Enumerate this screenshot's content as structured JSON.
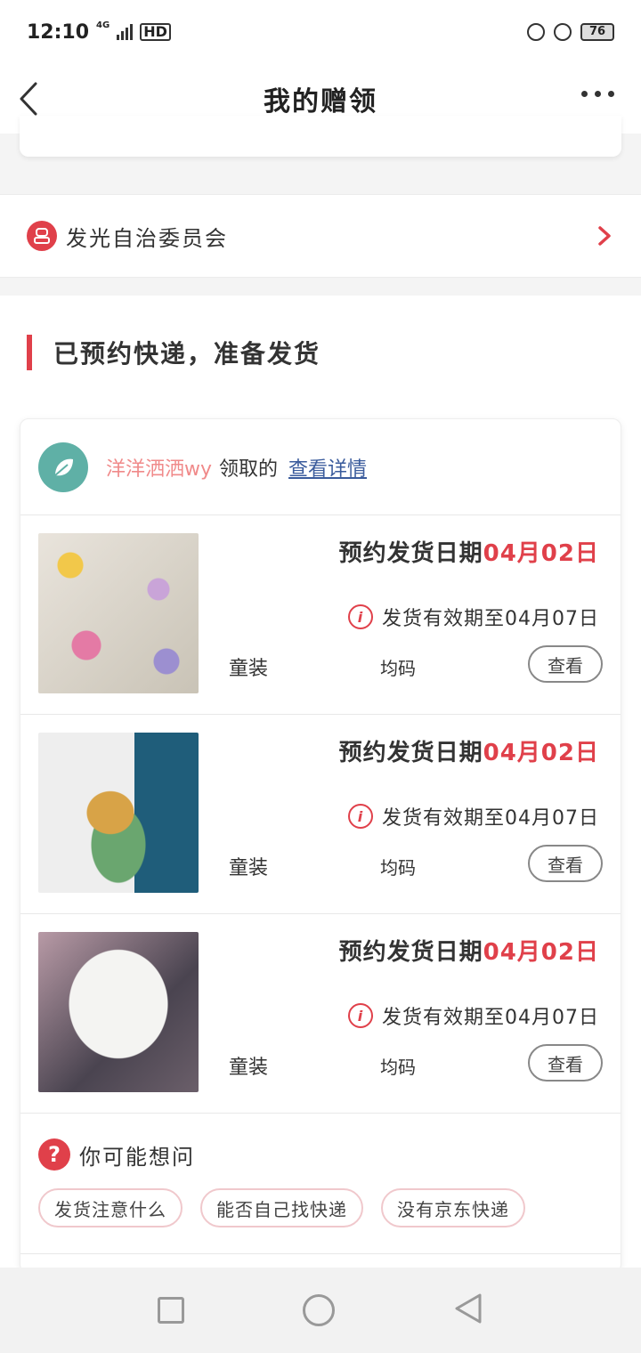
{
  "status_bar": {
    "time": "12:10",
    "network": "4G",
    "hd": "HD",
    "battery": "76"
  },
  "nav": {
    "title": "我的赠领"
  },
  "committee": {
    "label": "发光自治委员会"
  },
  "section": {
    "title": "已预约快递，准备发货"
  },
  "order": {
    "user_name": "洋洋洒洒wy",
    "claim_text": "领取的",
    "detail_link": "查看详情",
    "items": [
      {
        "ship_label": "预约发货日期",
        "ship_date": "04月02日",
        "validity": "发货有效期至04月07日",
        "category": "童装",
        "size": "均码",
        "view_label": "查看"
      },
      {
        "ship_label": "预约发货日期",
        "ship_date": "04月02日",
        "validity": "发货有效期至04月07日",
        "category": "童装",
        "size": "均码",
        "view_label": "查看"
      },
      {
        "ship_label": "预约发货日期",
        "ship_date": "04月02日",
        "validity": "发货有效期至04月07日",
        "category": "童装",
        "size": "均码",
        "view_label": "查看"
      }
    ]
  },
  "faq": {
    "title": "你可能想问",
    "questions": [
      "发货注意什么",
      "能否自己找快递",
      "没有京东快递"
    ]
  },
  "colors": {
    "accent": "#e0404a",
    "link": "#3a5b9c",
    "username": "#f08a8a"
  }
}
